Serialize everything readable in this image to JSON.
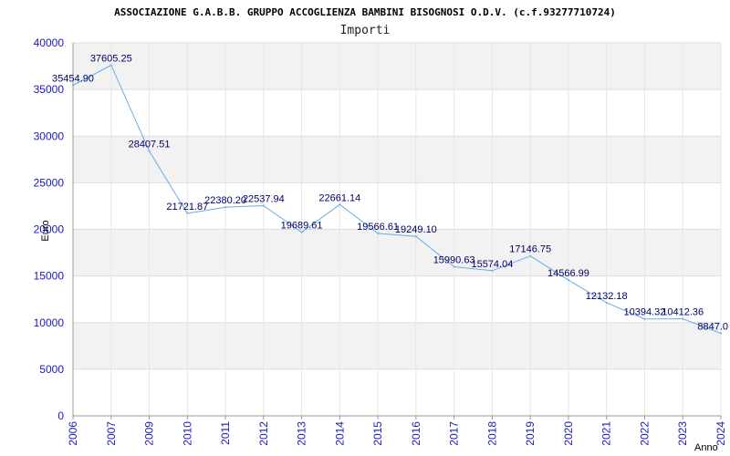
{
  "chart_data": {
    "type": "line",
    "title": "ASSOCIAZIONE G.A.B.B. GRUPPO ACCOGLIENZA BAMBINI BISOGNOSI O.D.V. (c.f.93277710724)",
    "subtitle": "Importi",
    "xlabel": "Anno",
    "ylabel": "Euro",
    "ylim": [
      0,
      40000
    ],
    "yticks": [
      0,
      5000,
      10000,
      15000,
      20000,
      25000,
      30000,
      35000,
      40000
    ],
    "x": [
      "2006",
      "2007",
      "2009",
      "2010",
      "2011",
      "2012",
      "2013",
      "2014",
      "2015",
      "2016",
      "2017",
      "2018",
      "2019",
      "2020",
      "2021",
      "2022",
      "2023",
      "2024"
    ],
    "values": [
      35454.9,
      37605.25,
      28407.51,
      21721.87,
      22380.2,
      22537.94,
      19689.61,
      22661.14,
      19566.61,
      19249.1,
      15990.63,
      15574.04,
      17146.75,
      14566.99,
      12132.18,
      10394.32,
      10412.36,
      8847.0
    ],
    "labels": [
      "35454.90",
      "37605.25",
      "28407.51",
      "21721.87",
      "22380.20",
      "22537.94",
      "19689.61",
      "22661.14",
      "19566.61",
      "19249.10",
      "15990.63",
      "15574.04",
      "17146.75",
      "14566.99",
      "12132.18",
      "10394.32",
      "10412.36",
      "8847.0"
    ],
    "line_color": "#6aaee8",
    "band_color": "#f2f2f2",
    "grid": true,
    "legend": false
  }
}
